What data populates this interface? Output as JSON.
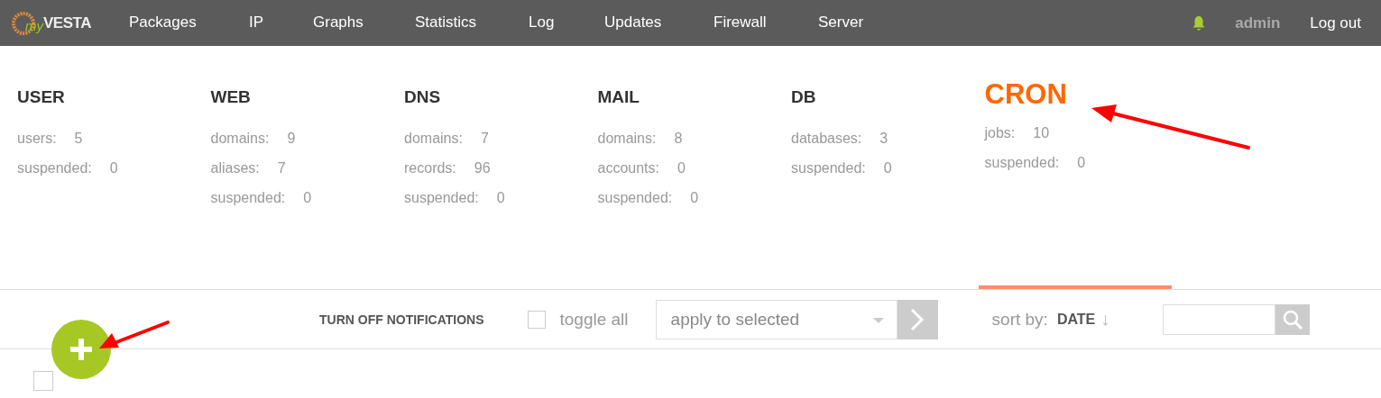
{
  "logo": {
    "prefix": "my",
    "name": "VESTA"
  },
  "nav": [
    "Packages",
    "IP",
    "Graphs",
    "Statistics",
    "Log",
    "Updates",
    "Firewall",
    "Server"
  ],
  "user_menu": {
    "username": "admin",
    "logout": "Log out"
  },
  "sections": [
    {
      "title": "USER",
      "selected": false,
      "stats": [
        {
          "label": "users:",
          "value": "5"
        },
        {
          "label": "suspended:",
          "value": "0"
        }
      ]
    },
    {
      "title": "WEB",
      "selected": false,
      "stats": [
        {
          "label": "domains:",
          "value": "9"
        },
        {
          "label": "aliases:",
          "value": "7"
        },
        {
          "label": "suspended:",
          "value": "0"
        }
      ]
    },
    {
      "title": "DNS",
      "selected": false,
      "stats": [
        {
          "label": "domains:",
          "value": "7"
        },
        {
          "label": "records:",
          "value": "96"
        },
        {
          "label": "suspended:",
          "value": "0"
        }
      ]
    },
    {
      "title": "MAIL",
      "selected": false,
      "stats": [
        {
          "label": "domains:",
          "value": "8"
        },
        {
          "label": "accounts:",
          "value": "0"
        },
        {
          "label": "suspended:",
          "value": "0"
        }
      ]
    },
    {
      "title": "DB",
      "selected": false,
      "stats": [
        {
          "label": "databases:",
          "value": "3"
        },
        {
          "label": "suspended:",
          "value": "0"
        }
      ]
    },
    {
      "title": "CRON",
      "selected": true,
      "stats": [
        {
          "label": "jobs:",
          "value": "10"
        },
        {
          "label": "suspended:",
          "value": "0"
        }
      ]
    }
  ],
  "toolbar": {
    "notifications": "TURN OFF NOTIFICATIONS",
    "toggle_all": {
      "label": "toggle all",
      "checked": false
    },
    "action_select": "apply to selected",
    "sort_label": "sort by:",
    "sort_field": "DATE",
    "sort_direction": "↓"
  },
  "list": [
    {
      "checked": false
    }
  ]
}
